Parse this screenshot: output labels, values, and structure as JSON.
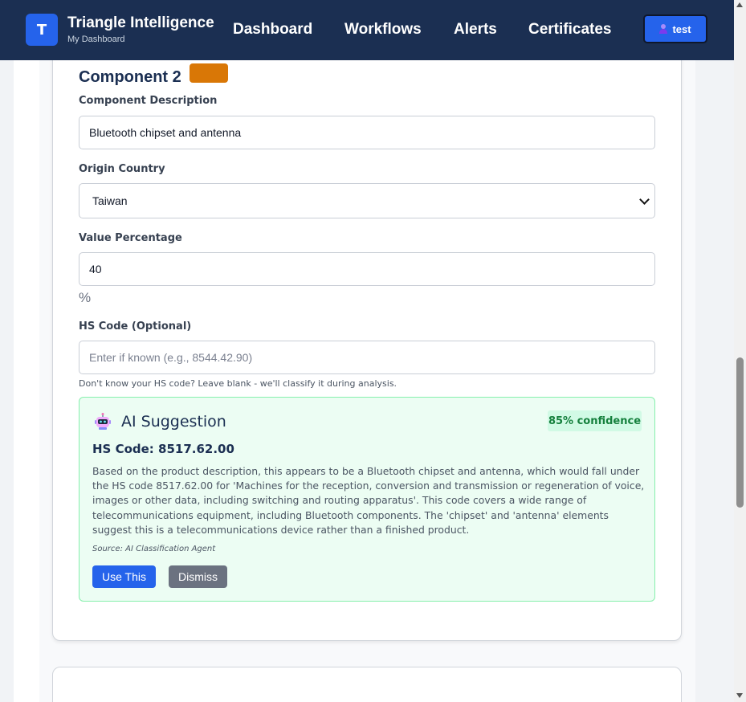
{
  "brand": {
    "logo_letter": "T",
    "title": "Triangle Intelligence",
    "subtitle": "My Dashboard"
  },
  "nav": {
    "dashboard": "Dashboard",
    "workflows": "Workflows",
    "alerts": "Alerts",
    "certificates": "Certificates",
    "user_label": "test"
  },
  "component": {
    "title": "Component 2",
    "badge_color": "#d97706",
    "description_label": "Component Description",
    "description_value": "Bluetooth chipset and antenna",
    "origin_label": "Origin Country",
    "origin_value": "Taiwan",
    "value_pct_label": "Value Percentage",
    "value_pct_value": "40",
    "pct_symbol": "%",
    "hs_label": "HS Code (Optional)",
    "hs_placeholder": "Enter if known (e.g., 8544.42.90)",
    "hint": "Don't know your HS code? Leave blank - we'll classify it during analysis."
  },
  "ai": {
    "icon": "robot-icon",
    "title": "AI Suggestion",
    "confidence": "85% confidence",
    "hs_code": "HS Code: 8517.62.00",
    "description": "Based on the product description, this appears to be a Bluetooth chipset and antenna, which would fall under the HS code 8517.62.00 for 'Machines for the reception, conversion and transmission or regeneration of voice, images or other data, including switching and routing apparatus'. This code covers a wide range of telecommunications equipment, including Bluetooth components. The 'chipset' and 'antenna' elements suggest this is a telecommunications device rather than a finished product.",
    "source": "Source: AI Classification Agent",
    "use_label": "Use This",
    "dismiss_label": "Dismiss"
  },
  "colors": {
    "header_bg": "#1b2f52",
    "accent": "#2563eb",
    "success_bg": "#ecfdf3",
    "success_text": "#15803d"
  }
}
